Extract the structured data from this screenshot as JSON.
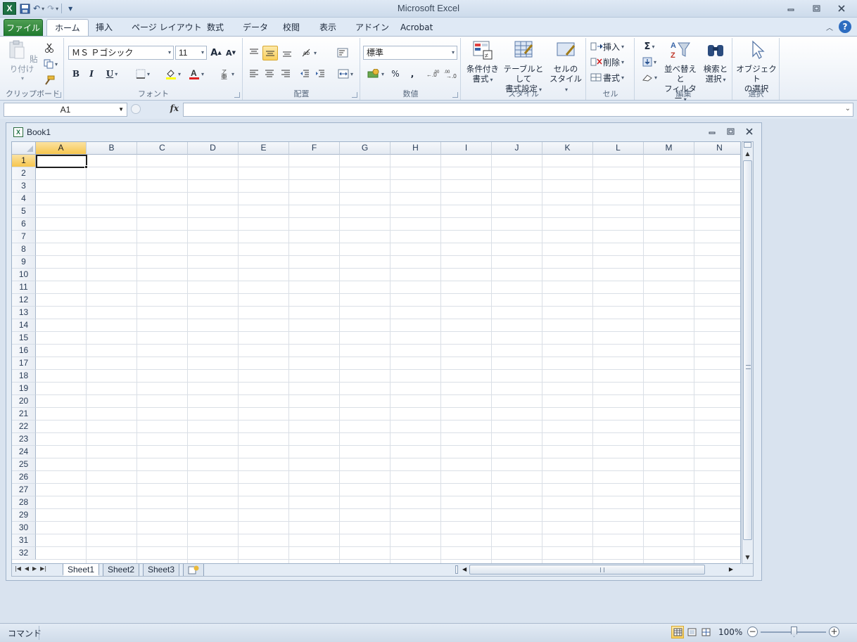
{
  "app": {
    "title": "Microsoft Excel"
  },
  "qat": {
    "undo": "↶",
    "redo": "↷",
    "customize": "▾"
  },
  "tabs": [
    {
      "label": "ファイル"
    },
    {
      "label": "ホーム"
    },
    {
      "label": "挿入"
    },
    {
      "label": "ページ レイアウト"
    },
    {
      "label": "数式"
    },
    {
      "label": "データ"
    },
    {
      "label": "校閲"
    },
    {
      "label": "表示"
    },
    {
      "label": "アドイン"
    },
    {
      "label": "Acrobat"
    }
  ],
  "ribbon": {
    "clipboard": {
      "label": "クリップボード",
      "paste": "貼り付け"
    },
    "font": {
      "label": "フォント",
      "name": "ＭＳ Ｐゴシック",
      "size": "11",
      "bold": "B",
      "italic": "I",
      "underline": "U",
      "grow": "A",
      "shrink": "A"
    },
    "alignment": {
      "label": "配置"
    },
    "number": {
      "label": "数値",
      "format": "標準",
      "percent": "%",
      "comma": ","
    },
    "styles": {
      "label": "スタイル",
      "conditional_line1": "条件付き",
      "conditional_line2": "書式",
      "table_line1": "テーブルとして",
      "table_line2": "書式設定",
      "cell_line1": "セルの",
      "cell_line2": "スタイル"
    },
    "cells": {
      "label": "セル",
      "insert": "挿入",
      "delete": "削除",
      "format": "書式"
    },
    "editing": {
      "label": "編集",
      "sigma": "Σ",
      "sort_line1": "並べ替えと",
      "sort_line2": "フィルター",
      "find_line1": "検索と",
      "find_line2": "選択"
    },
    "selection": {
      "label": "選択",
      "object_line1": "オブジェクト",
      "object_line2": "の選択"
    }
  },
  "formula_bar": {
    "name_box": "A1",
    "fx": "fx",
    "value": ""
  },
  "workbook": {
    "title": "Book1",
    "columns": [
      "A",
      "B",
      "C",
      "D",
      "E",
      "F",
      "G",
      "H",
      "I",
      "J",
      "K",
      "L",
      "M",
      "N"
    ],
    "rows": [
      "1",
      "2",
      "3",
      "4",
      "5",
      "6",
      "7",
      "8",
      "9",
      "10",
      "11",
      "12",
      "13",
      "14",
      "15",
      "16",
      "17",
      "18",
      "19",
      "20",
      "21",
      "22",
      "23",
      "24",
      "25",
      "26",
      "27",
      "28",
      "29",
      "30",
      "31",
      "32"
    ],
    "active_cell": "A1",
    "sheets": [
      {
        "name": "Sheet1",
        "active": true
      },
      {
        "name": "Sheet2",
        "active": false
      },
      {
        "name": "Sheet3",
        "active": false
      }
    ]
  },
  "status": {
    "mode": "コマンド",
    "zoom": "100%"
  },
  "colors": {
    "file_tab": "#1f7a2e",
    "selection": "#f6c54e",
    "chrome": "#dfe9f5"
  }
}
